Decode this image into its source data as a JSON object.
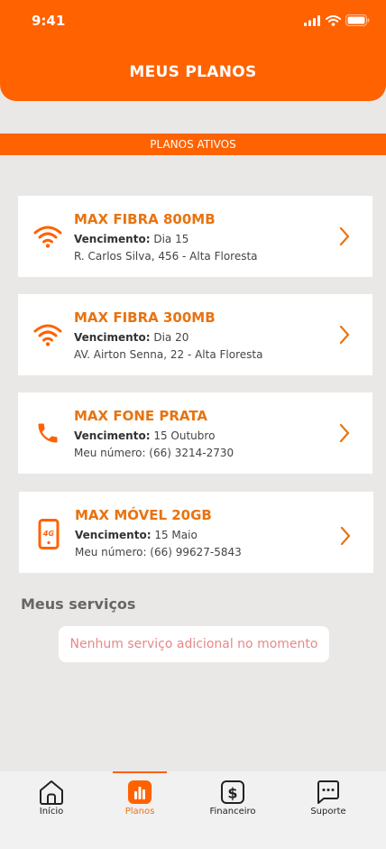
{
  "status": {
    "time": "9:41"
  },
  "header": {
    "title": "MEUS PLANOS"
  },
  "section": {
    "label": "PLANOS ATIVOS"
  },
  "plans": [
    {
      "icon": "wifi-icon",
      "title": "MAX FIBRA 800MB",
      "due_label": "Vencimento:",
      "due_value": "Dia 15",
      "detail": "R. Carlos Silva, 456 - Alta Floresta"
    },
    {
      "icon": "wifi-icon",
      "title": "MAX FIBRA 300MB",
      "due_label": "Vencimento:",
      "due_value": "Dia 20",
      "detail": "AV. Airton Senna, 22 - Alta Floresta"
    },
    {
      "icon": "phone-icon",
      "title": "MAX FONE PRATA",
      "due_label": "Vencimento:",
      "due_value": "15 Outubro",
      "detail": "Meu número: (66) 3214-2730"
    },
    {
      "icon": "mobile-4g-icon",
      "title": "MAX MÓVEL 20GB",
      "due_label": "Vencimento:",
      "due_value": "15 Maio",
      "detail": "Meu número: (66) 99627-5843"
    }
  ],
  "services": {
    "title": "Meus serviços",
    "empty_text": "Nenhum serviço adicional no momento"
  },
  "tabs": [
    {
      "icon": "home-icon",
      "label": "Início"
    },
    {
      "icon": "chart-icon",
      "label": "Planos"
    },
    {
      "icon": "dollar-icon",
      "label": "Financeiro"
    },
    {
      "icon": "chat-icon",
      "label": "Suporte"
    }
  ],
  "colors": {
    "brand": "#ff6200",
    "title_orange": "#e8730f",
    "empty_text": "#e98787"
  }
}
